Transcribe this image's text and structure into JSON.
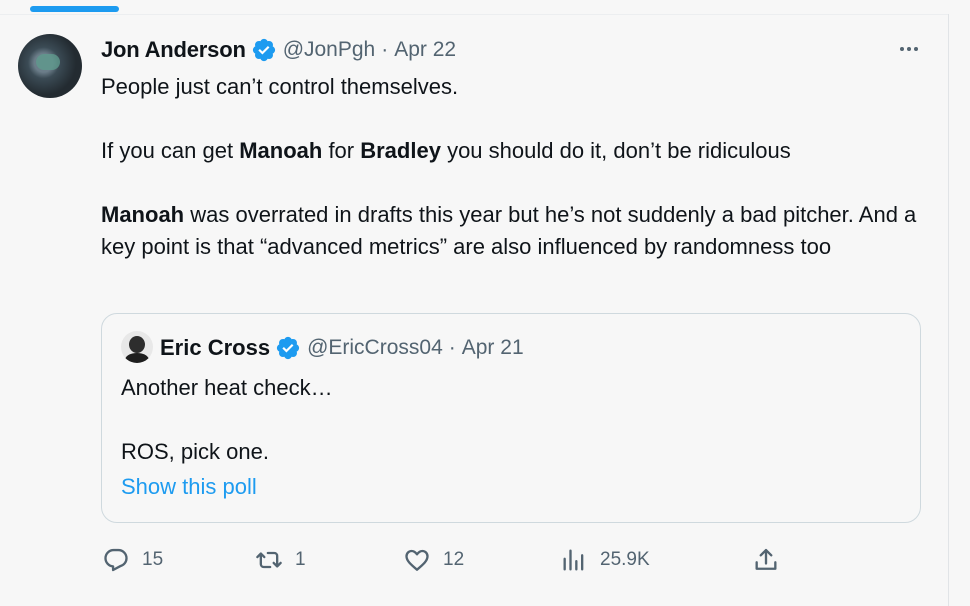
{
  "tweet": {
    "author": "Jon Anderson",
    "handle": "@JonPgh",
    "separator": "·",
    "date": "Apr 22",
    "line1": "People just can’t control themselves.",
    "line2": {
      "a": "If you can get ",
      "b": "Manoah",
      "c": " for ",
      "d": "Bradley",
      "e": " you should do it, don’t be ridiculous"
    },
    "line3": {
      "a": "Manoah",
      "b": " was overrated in drafts this year but he’s not suddenly a bad pitcher. And a key point is that “advanced metrics” are also influenced by randomness too"
    }
  },
  "quote": {
    "author": "Eric Cross",
    "handle": "@EricCross04",
    "separator": "·",
    "date": "Apr 21",
    "line1": "Another heat check…",
    "line2": "ROS, pick one.",
    "poll_link": "Show this poll"
  },
  "actions": {
    "replies": "15",
    "retweets": "1",
    "likes": "12",
    "views": "25.9K"
  },
  "colors": {
    "accent": "#1d9bf0",
    "muted": "#536471",
    "text": "#0f1419"
  },
  "icons": [
    "verified-badge-icon",
    "more-icon",
    "reply-icon",
    "retweet-icon",
    "like-icon",
    "views-icon",
    "share-icon"
  ]
}
